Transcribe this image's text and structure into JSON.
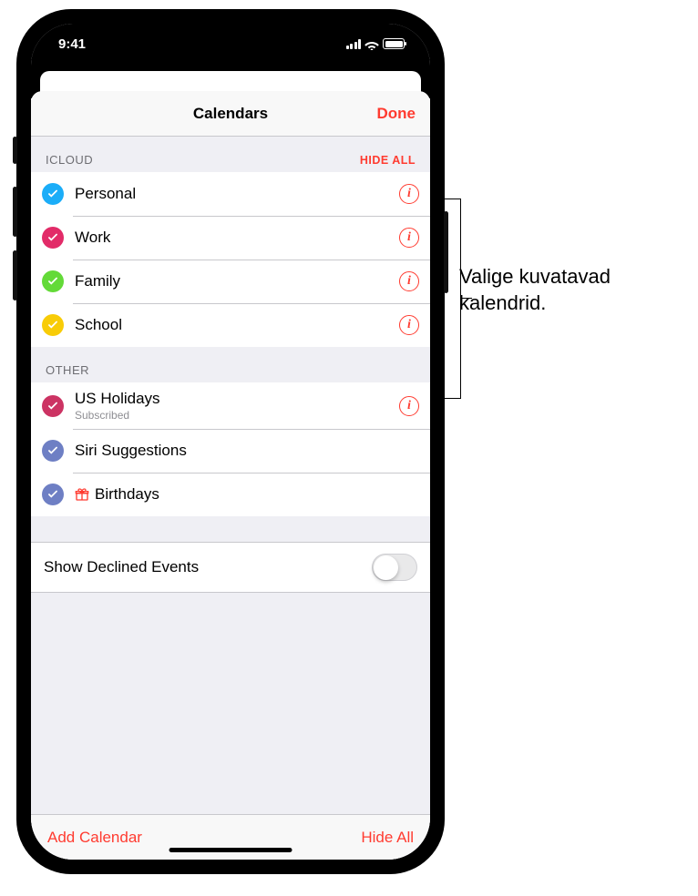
{
  "status": {
    "time": "9:41"
  },
  "nav": {
    "title": "Calendars",
    "done": "Done"
  },
  "sections": [
    {
      "title": "ICLOUD",
      "action": "HIDE ALL",
      "items": [
        {
          "label": "Personal",
          "color": "#1badf8",
          "info": true
        },
        {
          "label": "Work",
          "color": "#e22b68",
          "info": true
        },
        {
          "label": "Family",
          "color": "#63da38",
          "info": true
        },
        {
          "label": "School",
          "color": "#f8cc07",
          "info": true
        }
      ]
    },
    {
      "title": "OTHER",
      "items": [
        {
          "label": "US Holidays",
          "sub": "Subscribed",
          "color": "#cc3363",
          "info": true
        },
        {
          "label": "Siri Suggestions",
          "color": "#6e7fc4",
          "info": false
        },
        {
          "label": "Birthdays",
          "color": "#6e7fc4",
          "info": false,
          "gift": true
        }
      ]
    }
  ],
  "settings": {
    "declined": "Show Declined Events",
    "declined_on": false
  },
  "toolbar": {
    "add": "Add Calendar",
    "hide": "Hide All"
  },
  "callout": "Valige kuvatavad kalendrid."
}
